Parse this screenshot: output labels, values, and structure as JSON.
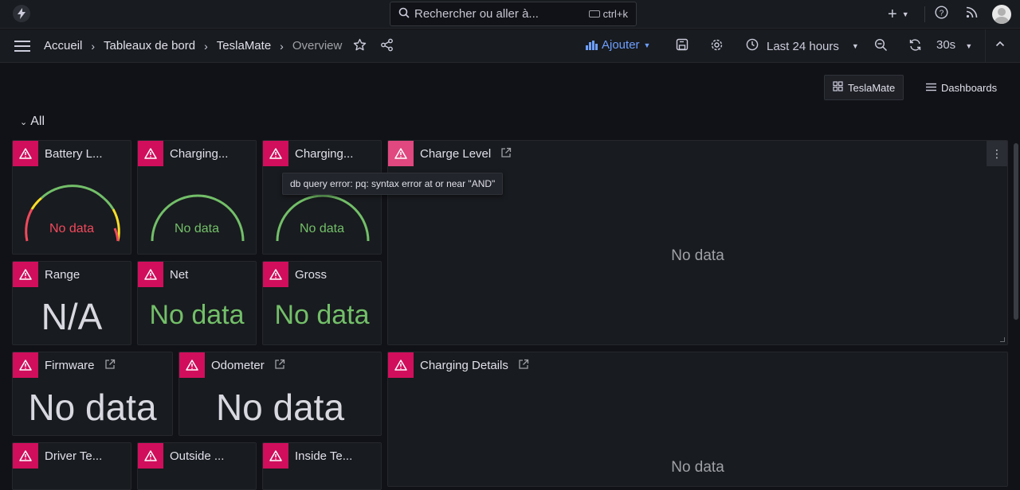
{
  "topbar": {
    "search_placeholder": "Rechercher ou aller à...",
    "shortcut": "ctrl+k"
  },
  "breadcrumb": [
    "Accueil",
    "Tableaux de bord",
    "TeslaMate",
    "Overview"
  ],
  "toolbar": {
    "add_label": "Ajouter",
    "time_range": "Last 24 hours",
    "refresh_interval": "30s"
  },
  "dashboard_links": {
    "teslamate": "TeslaMate",
    "dashboards": "Dashboards"
  },
  "row_title": "All",
  "panels": {
    "battery_level": {
      "title": "Battery L...",
      "value": "No data"
    },
    "charging_1": {
      "title": "Charging...",
      "value": "No data"
    },
    "charging_2": {
      "title": "Charging...",
      "value": "No data"
    },
    "charge_level": {
      "title": "Charge Level",
      "value": "No data"
    },
    "range": {
      "title": "Range",
      "value": "N/A"
    },
    "net": {
      "title": "Net",
      "value": "No data"
    },
    "gross": {
      "title": "Gross",
      "value": "No data"
    },
    "firmware": {
      "title": "Firmware",
      "value": "No data"
    },
    "odometer": {
      "title": "Odometer",
      "value": "No data"
    },
    "charging_details": {
      "title": "Charging Details",
      "value": "No data"
    },
    "driver_temp": {
      "title": "Driver Te..."
    },
    "outside_temp": {
      "title": "Outside ..."
    },
    "inside_temp": {
      "title": "Inside Te..."
    }
  },
  "tooltip": "db query error: pq: syntax error at or near \"AND\"",
  "colors": {
    "error": "#d10e5c",
    "accent": "#6e9fff",
    "nodata_green": "#73bf69",
    "nodata_red": "#f2495c"
  }
}
